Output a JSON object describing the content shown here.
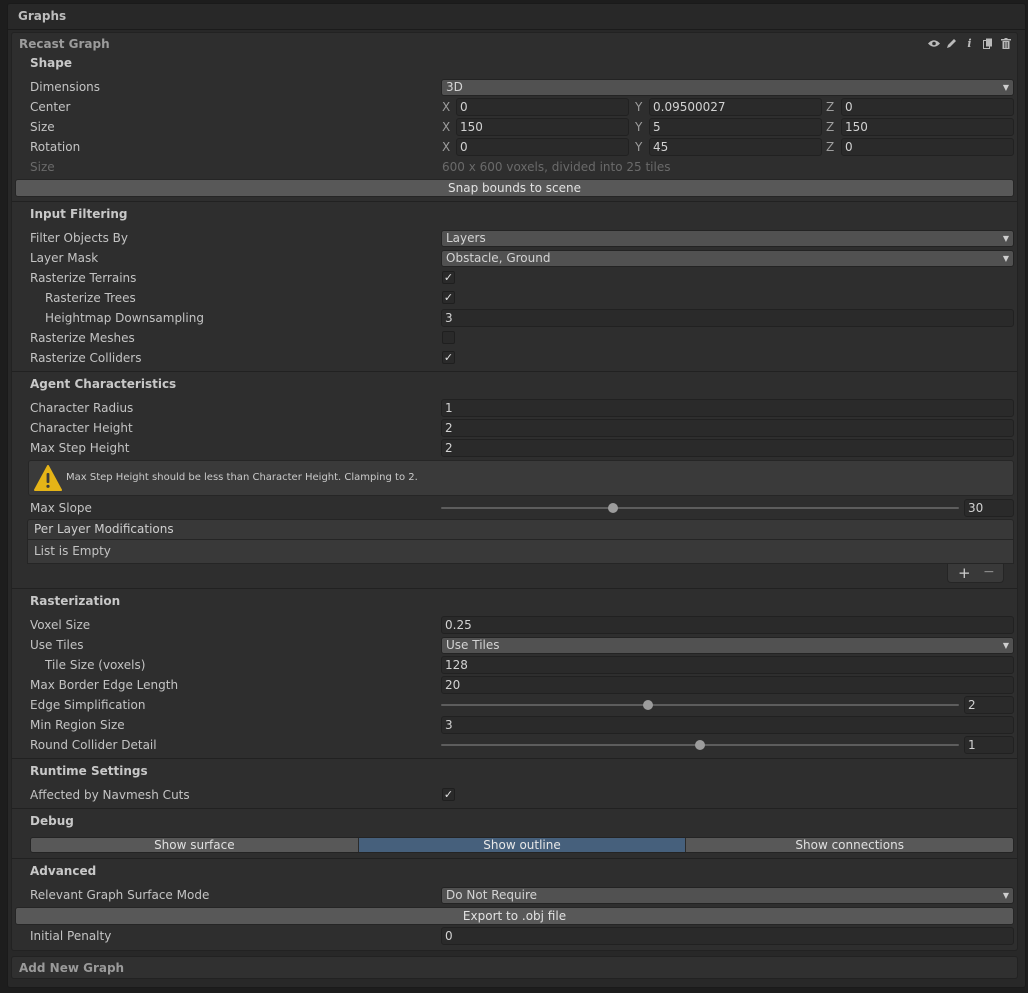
{
  "panel": {
    "title": "Graphs",
    "add_graph_label": "Add New Graph"
  },
  "graph": {
    "title": "Recast Graph",
    "header_icons": [
      "eye-icon",
      "pencil-icon",
      "info-icon",
      "duplicate-icon",
      "trash-icon"
    ]
  },
  "shape": {
    "section": "Shape",
    "dimensions_label": "Dimensions",
    "dimensions_value": "3D",
    "center_label": "Center",
    "center": {
      "x": "0",
      "y": "0.09500027",
      "z": "0"
    },
    "size_label": "Size",
    "size": {
      "x": "150",
      "y": "5",
      "z": "150"
    },
    "rotation_label": "Rotation",
    "rotation": {
      "x": "0",
      "y": "45",
      "z": "0"
    },
    "info_label": "Size",
    "info_value": "600 x 600 voxels, divided into 25 tiles",
    "axis_x": "X",
    "axis_y": "Y",
    "axis_z": "Z",
    "snap_button": "Snap bounds to scene"
  },
  "input_filtering": {
    "section": "Input Filtering",
    "filter_by_label": "Filter Objects By",
    "filter_by_value": "Layers",
    "layer_mask_label": "Layer Mask",
    "layer_mask_value": "Obstacle, Ground",
    "rasterize_terrains_label": "Rasterize Terrains",
    "rasterize_terrains": true,
    "rasterize_trees_label": "Rasterize Trees",
    "rasterize_trees": true,
    "heightmap_label": "Heightmap Downsampling",
    "heightmap_value": "3",
    "rasterize_meshes_label": "Rasterize Meshes",
    "rasterize_meshes": false,
    "rasterize_colliders_label": "Rasterize Colliders",
    "rasterize_colliders": true
  },
  "agent": {
    "section": "Agent Characteristics",
    "radius_label": "Character Radius",
    "radius_value": "1",
    "height_label": "Character Height",
    "height_value": "2",
    "step_label": "Max Step Height",
    "step_value": "2",
    "warning": "Max Step Height should be less than Character Height. Clamping to 2.",
    "slope_label": "Max Slope",
    "slope_value": "30",
    "slope_fraction": 0.333,
    "per_layer_label": "Per Layer Modifications",
    "list_empty": "List is Empty",
    "add_glyph": "+",
    "remove_glyph": "−"
  },
  "rasterization": {
    "section": "Rasterization",
    "voxel_label": "Voxel Size",
    "voxel_value": "0.25",
    "use_tiles_label": "Use Tiles",
    "use_tiles_value": "Use Tiles",
    "tile_size_label": "Tile Size (voxels)",
    "tile_size_value": "128",
    "border_label": "Max Border Edge Length",
    "border_value": "20",
    "edge_label": "Edge Simplification",
    "edge_value": "2",
    "edge_fraction": 0.4,
    "region_label": "Min Region Size",
    "region_value": "3",
    "round_label": "Round Collider Detail",
    "round_value": "1",
    "round_fraction": 0.5
  },
  "runtime": {
    "section": "Runtime Settings",
    "navmesh_cuts_label": "Affected by Navmesh Cuts",
    "navmesh_cuts": true
  },
  "debug": {
    "section": "Debug",
    "tabs": [
      "Show surface",
      "Show outline",
      "Show connections"
    ],
    "active_tab": 1
  },
  "advanced": {
    "section": "Advanced",
    "surface_mode_label": "Relevant Graph Surface Mode",
    "surface_mode_value": "Do Not Require",
    "export_button": "Export to .obj file",
    "penalty_label": "Initial Penalty",
    "penalty_value": "0"
  },
  "colors": {
    "active_tab": "#46607c",
    "warning_icon": "#e5b417"
  }
}
